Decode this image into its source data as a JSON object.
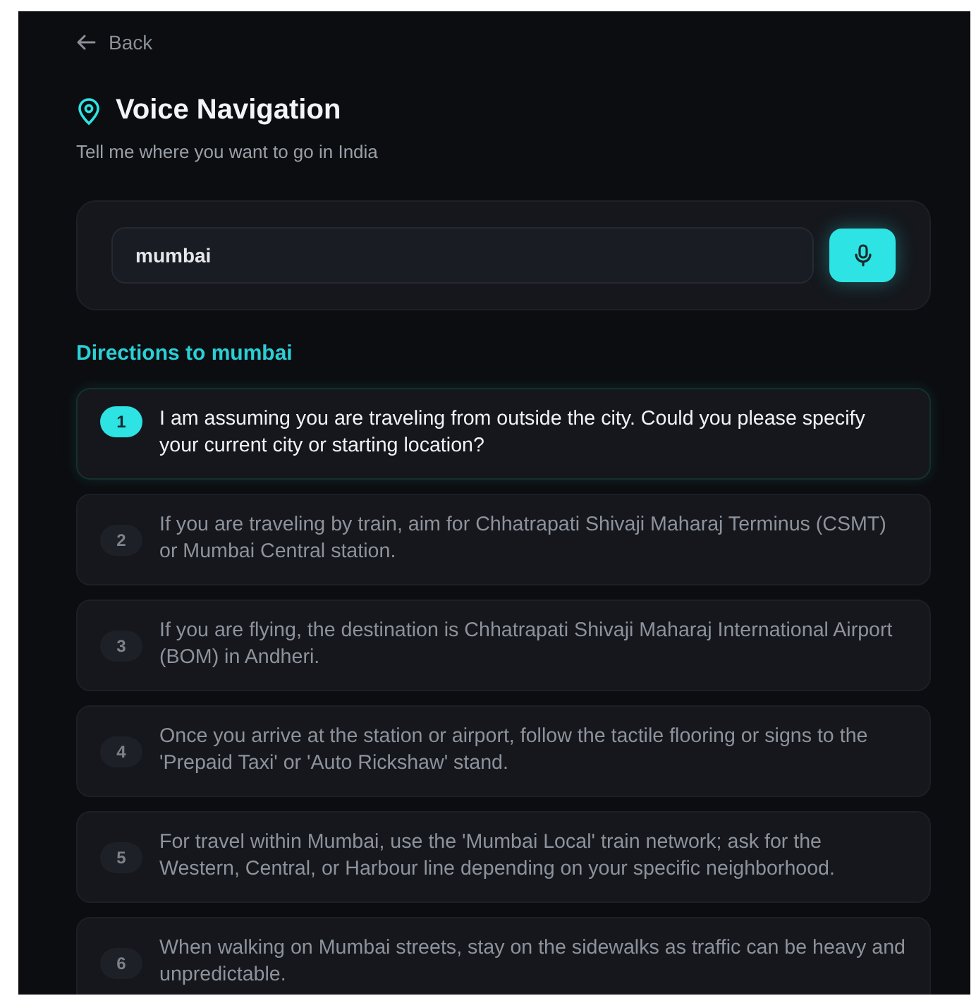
{
  "back": {
    "label": "Back"
  },
  "header": {
    "title": "Voice Navigation",
    "subtitle": "Tell me where you want to go in India"
  },
  "search": {
    "value": "mumbai"
  },
  "directions": {
    "heading": "Directions to mumbai",
    "steps": [
      {
        "number": "1",
        "text": "I am assuming you are traveling from outside the city. Could you please specify your current city or starting location?",
        "active": true
      },
      {
        "number": "2",
        "text": "If you are traveling by train, aim for Chhatrapati Shivaji Maharaj Terminus (CSMT) or Mumbai Central station.",
        "active": false
      },
      {
        "number": "3",
        "text": "If you are flying, the destination is Chhatrapati Shivaji Maharaj International Airport (BOM) in Andheri.",
        "active": false
      },
      {
        "number": "4",
        "text": "Once you arrive at the station or airport, follow the tactile flooring or signs to the 'Prepaid Taxi' or 'Auto Rickshaw' stand.",
        "active": false
      },
      {
        "number": "5",
        "text": "For travel within Mumbai, use the 'Mumbai Local' train network; ask for the Western, Central, or Harbour line depending on your specific neighborhood.",
        "active": false
      },
      {
        "number": "6",
        "text": "When walking on Mumbai streets, stay on the sidewalks as traffic can be heavy and unpredictable.",
        "active": false
      }
    ]
  }
}
